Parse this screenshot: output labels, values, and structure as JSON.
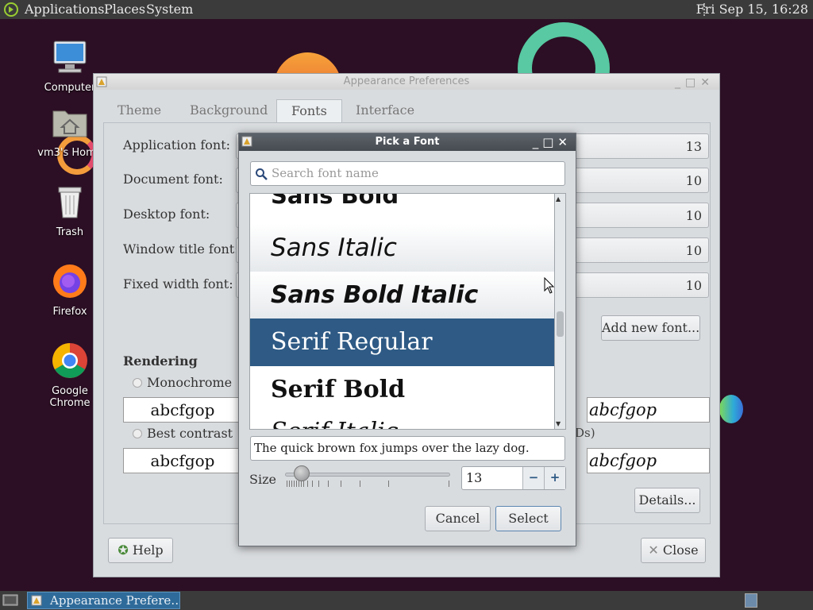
{
  "top_panel": {
    "menus": [
      "Applications",
      "Places",
      "System"
    ],
    "clock": "Fri Sep 15, 16:28"
  },
  "desktop": {
    "icons": [
      {
        "label": "Computer",
        "icon": "computer-icon"
      },
      {
        "label": "vm3's Home",
        "icon": "home-folder-icon"
      },
      {
        "label": "Trash",
        "icon": "trash-icon"
      },
      {
        "label": "Firefox",
        "icon": "firefox-icon"
      },
      {
        "label": "Google Chrome",
        "icon": "chrome-icon"
      }
    ]
  },
  "appearance": {
    "title": "Appearance Preferences",
    "tabs": [
      "Theme",
      "Background",
      "Fonts",
      "Interface"
    ],
    "active_tab": "Fonts",
    "fonts": [
      {
        "label": "Application font:",
        "size": "13"
      },
      {
        "label": "Document font:",
        "size": "10"
      },
      {
        "label": "Desktop font:",
        "size": "10"
      },
      {
        "label": "Window title font:",
        "size": "10"
      },
      {
        "label": "Fixed width font:",
        "size": "10"
      }
    ],
    "add_font_label": "Add new font...",
    "rendering": {
      "heading": "Rendering",
      "options": [
        {
          "label": "Monochrome",
          "sample": "abcfgop"
        },
        {
          "label": "Best contrast",
          "sample": "abcfgop"
        }
      ],
      "right_samples": [
        "abcfgop",
        "abcfgop"
      ],
      "fragment": "Ds)"
    },
    "details_label": "Details...",
    "help_label": "Help",
    "close_label": "Close"
  },
  "font_dialog": {
    "title": "Pick a Font",
    "search_placeholder": "Search font name",
    "fonts": [
      "Sans Bold",
      "Sans Italic",
      "Sans Bold Italic",
      "Serif Regular",
      "Serif Bold",
      "Serif Italic"
    ],
    "selected": "Serif Regular",
    "preview_text": "The quick brown fox jumps over the lazy dog.",
    "size_label": "Size",
    "size_value": "13",
    "minus": "−",
    "plus": "+",
    "cancel_label": "Cancel",
    "select_label": "Select"
  },
  "taskbar": {
    "task_label": "Appearance Prefere…"
  },
  "colors": {
    "selection": "#2e5a85",
    "desktop_bg": "#2c0f24",
    "panel_bg": "#3b3b3b"
  }
}
